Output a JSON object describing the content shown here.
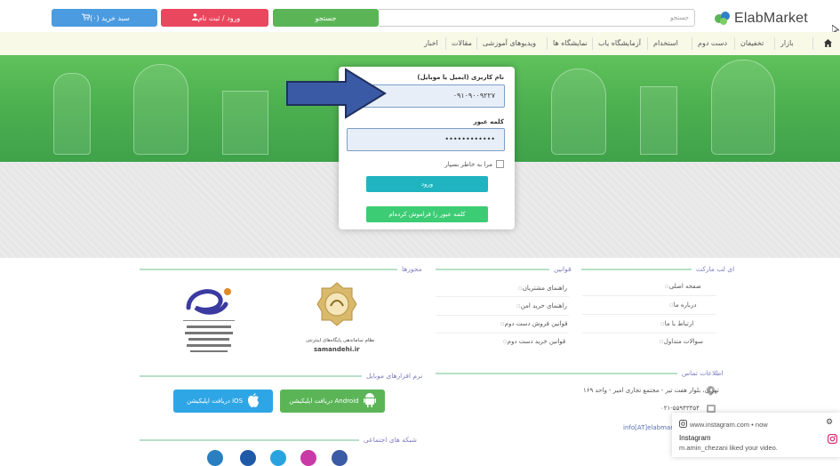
{
  "topbar": {
    "cart_label": "سبد خرید (۰)",
    "login_label": "ورود / ثبت نام",
    "search_button": "جستجو",
    "search_placeholder": "جستجو",
    "logo_text": "ElabMarket"
  },
  "nav": {
    "items": [
      "بازار",
      "تخفیفان",
      "دست دوم",
      "استخدام",
      "آزمایشگاه یاب",
      "نمایشگاه ها",
      "ویدیوهای آموزشی",
      "مقالات",
      "اخبار"
    ]
  },
  "login": {
    "username_label": "نام کاربری (ایمیل یا موبایل)",
    "username_value": "۰۹۱۰۹۰۰۹۲۲۷",
    "password_label": "کلمه عبور",
    "password_value": "••••••••••••",
    "remember_label": "مرا به خاطر بسپار",
    "enter_button": "ورود",
    "forgot_button": "کلمه عبور را فراموش کرده‌ام"
  },
  "footer": {
    "about": {
      "title": "ای لب مارکت",
      "links": [
        "صفحه اصلی",
        "درباره ما",
        "ارتباط با ما",
        "سوالات متداول"
      ]
    },
    "rules": {
      "title": "قوانین",
      "links": [
        "راهنمای مشتریان",
        "راهنمای خرید امن",
        "قوانین فروش دست دوم",
        "قوانین خرید دست دوم"
      ]
    },
    "licenses": {
      "title": "مجوزها",
      "samandehi_caption": "samandehi.ir",
      "samandehi_sub": "نظام ساماندهی پایگاه‌های اینترنتی"
    },
    "contact": {
      "title": "اطلاعات تماس",
      "address": "تهران، بلوار هفت تیر - مجتمع تجاری امیر - واحد ۱۶۹",
      "phone": "۰۲۱-۵۵۹۴۳۳۵۴",
      "email": "info[AT]elabmark"
    },
    "apps": {
      "title": "نرم افزارهای موبایل",
      "android_label": "دریافت اپلیکیشن Android",
      "ios_label": "دریافت اپلیکیشن iOS"
    },
    "social": {
      "title": "شبکه های اجتماعی"
    }
  },
  "toast": {
    "source": "www.instagram.com • now",
    "title": "Instagram",
    "message": "m.amin_chezani liked your video."
  }
}
